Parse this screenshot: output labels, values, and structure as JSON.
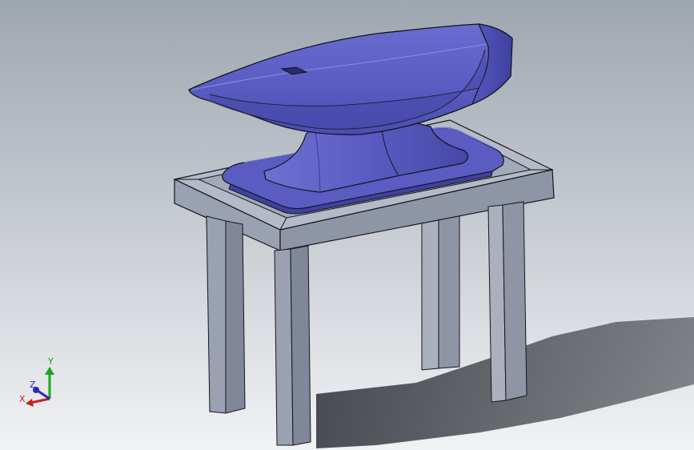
{
  "viewport": {
    "background_top": "#9ea6b0",
    "background_bottom": "#f1f2f4"
  },
  "model": {
    "anvil_color": "#5a5cc2",
    "anvil_highlight": "#8486e0",
    "anvil_shadow": "#3a3c96",
    "stand_top_color": "#b4bac6",
    "stand_side_color": "#8e96a6",
    "stand_dark_color": "#6e7586",
    "edge_color": "#15151c",
    "shadow_color": "#2e3038"
  },
  "triad": {
    "x_label": "X",
    "y_label": "Y",
    "z_label": "Z",
    "x_color": "#c82020",
    "y_color": "#18a818",
    "z_color": "#2a2ab8"
  }
}
